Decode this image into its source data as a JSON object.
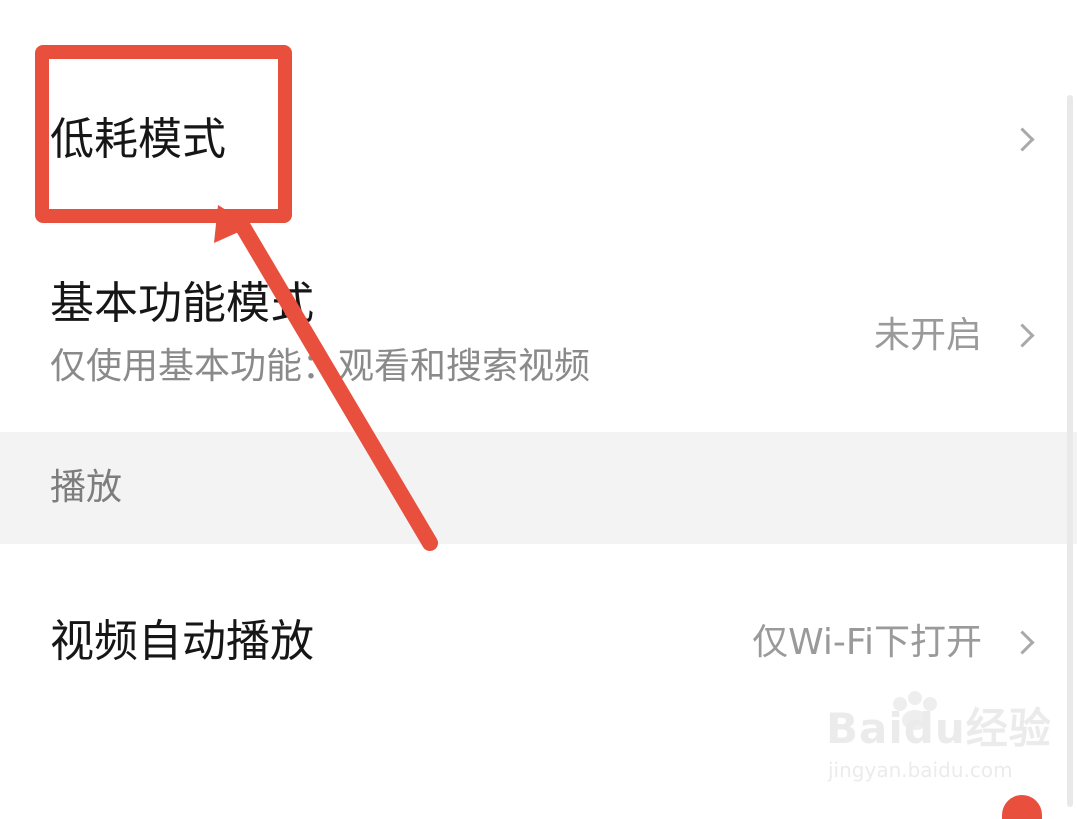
{
  "settings": {
    "low_power_mode": {
      "title": "低耗模式"
    },
    "basic_mode": {
      "title": "基本功能模式",
      "subtitle": "仅使用基本功能：观看和搜索视频",
      "value": "未开启"
    },
    "playback_section": {
      "label": "播放"
    },
    "autoplay": {
      "title": "视频自动播放",
      "value": "仅Wi-Fi下打开"
    }
  },
  "annotation": {
    "highlight_color": "#e84f3d"
  },
  "watermark": {
    "brand": "Baidu经验",
    "url": "jingyan.baidu.com"
  },
  "colors": {
    "background": "#ffffff",
    "section_background": "#f3f3f3",
    "primary_text": "#161616",
    "secondary_text": "#8a8a8a",
    "chevron": "#a9a9a9"
  }
}
